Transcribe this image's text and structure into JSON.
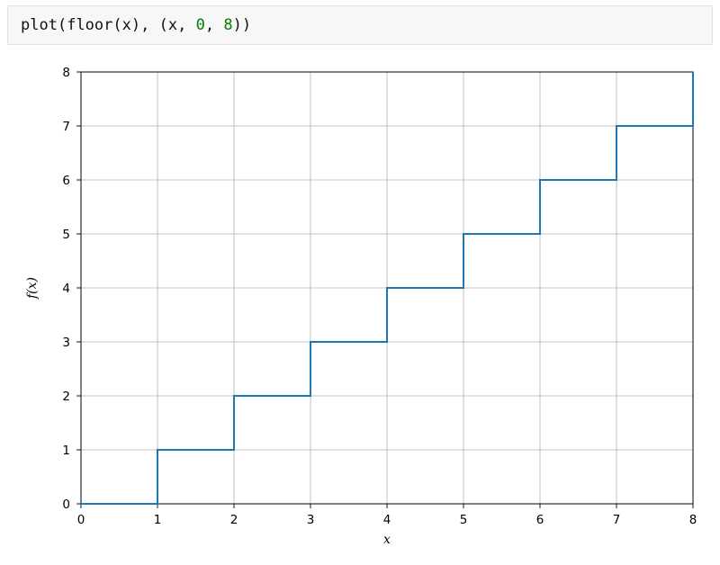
{
  "code": {
    "t1": "plot",
    "t2": "(",
    "t3": "floor",
    "t4": "(",
    "t5": "x",
    "t6": ")",
    "t7": ", ",
    "t8": "(",
    "t9": "x",
    "t10": ", ",
    "t11": "0",
    "t12": ", ",
    "t13": "8",
    "t14": ")",
    "t15": ")"
  },
  "chart_data": {
    "type": "line",
    "function": "floor(x)",
    "x": [
      0,
      1,
      1,
      2,
      2,
      3,
      3,
      4,
      4,
      5,
      5,
      6,
      6,
      7,
      7,
      8,
      8
    ],
    "y": [
      0,
      0,
      1,
      1,
      2,
      2,
      3,
      3,
      4,
      4,
      5,
      5,
      6,
      6,
      7,
      7,
      8
    ],
    "xlabel": "x",
    "ylabel": "f(x)",
    "xlim": [
      0,
      8
    ],
    "ylim": [
      0,
      8
    ],
    "xticks": [
      0,
      1,
      2,
      3,
      4,
      5,
      6,
      7,
      8
    ],
    "yticks": [
      0,
      1,
      2,
      3,
      4,
      5,
      6,
      7,
      8
    ],
    "grid": true,
    "line_color": "#1f77b4"
  }
}
